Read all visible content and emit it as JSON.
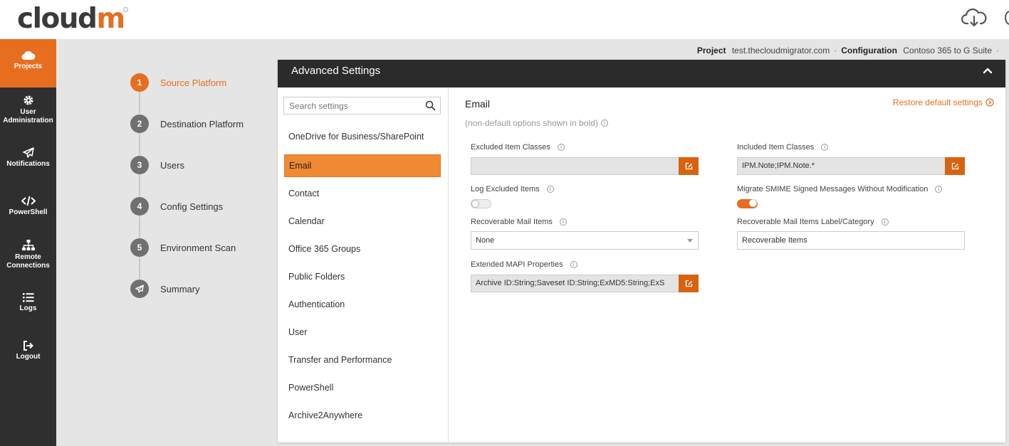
{
  "brand": {
    "logo_prefix": "cloud",
    "logo_suffix": "m",
    "accent": "#e66e1e"
  },
  "header": {
    "download_icon": "cloud-download-icon"
  },
  "nav": {
    "items": [
      {
        "label": "Projects",
        "icon": "cloud-icon",
        "active": true
      },
      {
        "label": "User Administration",
        "icon": "gear-icon"
      },
      {
        "label": "Notifications",
        "icon": "paper-plane-icon"
      },
      {
        "label": "PowerShell",
        "icon": "code-icon"
      },
      {
        "label": "Remote Connections",
        "icon": "network-icon"
      },
      {
        "label": "Logs",
        "icon": "list-icon"
      },
      {
        "label": "Logout",
        "icon": "logout-icon"
      }
    ]
  },
  "project_bar": {
    "project_label": "Project",
    "project_value": "test.thecloudmigrator.com",
    "separator": "·",
    "config_label": "Configuration",
    "config_value": "Contoso 365 to G Suite",
    "trailing": "·"
  },
  "steps": [
    {
      "number": "1",
      "label": "Source Platform",
      "active": true
    },
    {
      "number": "2",
      "label": "Destination Platform"
    },
    {
      "number": "3",
      "label": "Users"
    },
    {
      "number": "4",
      "label": "Config Settings"
    },
    {
      "number": "5",
      "label": "Environment Scan"
    },
    {
      "number": "",
      "label": "Summary",
      "icon": "paper-plane-icon"
    }
  ],
  "panel": {
    "title": "Advanced Settings",
    "search_placeholder": "Search settings",
    "categories": [
      "OneDrive for Business/SharePoint",
      "Email",
      "Contact",
      "Calendar",
      "Office 365 Groups",
      "Public Folders",
      "Authentication",
      "User",
      "Transfer and Performance",
      "PowerShell",
      "Archive2Anywhere"
    ],
    "selected_category": "Email"
  },
  "detail": {
    "title": "Email",
    "restore_label": "Restore default settings",
    "note": "(non-default options shown in bold)",
    "fields": {
      "excluded_item_classes": {
        "label": "Excluded Item Classes",
        "value": ""
      },
      "included_item_classes": {
        "label": "Included Item Classes",
        "value": "IPM.Note;IPM.Note.*"
      },
      "log_excluded_items": {
        "label": "Log Excluded Items",
        "value": "off"
      },
      "migrate_smime": {
        "label": "Migrate SMIME Signed Messages Without Modification",
        "value": "on"
      },
      "recoverable_mail_items": {
        "label": "Recoverable Mail Items",
        "value": "None"
      },
      "recoverable_label": {
        "label": "Recoverable Mail Items Label/Category",
        "value": "Recoverable Items"
      },
      "extended_mapi": {
        "label": "Extended MAPI Properties",
        "value": "Archive ID:String;Saveset ID:String;ExMD5:String;ExS"
      }
    }
  }
}
